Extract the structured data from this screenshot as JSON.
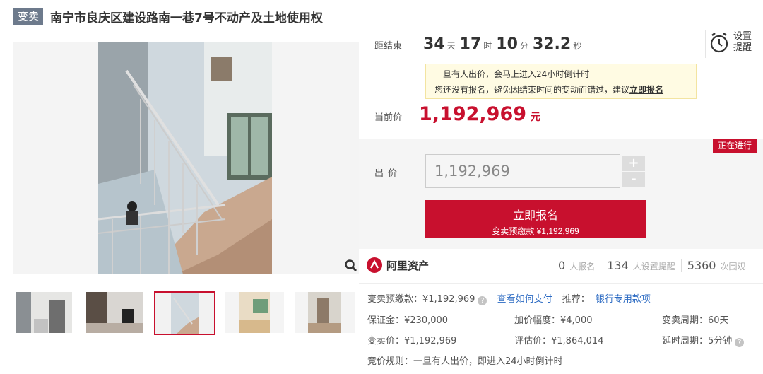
{
  "header": {
    "tag": "变卖",
    "title": "南宁市良庆区建设路南一巷7号不动产及土地使用权"
  },
  "countdown": {
    "label": "距结束",
    "days": "34",
    "days_unit": "天",
    "hours": "17",
    "hours_unit": "时",
    "minutes": "10",
    "minutes_unit": "分",
    "seconds": "32.2",
    "seconds_unit": "秒"
  },
  "reminder": {
    "label": "设置提醒",
    "icon": "alarm-clock-icon"
  },
  "notice": {
    "line1": "一旦有人出价，会马上进入24小时倒计时",
    "line2_prefix": "您还没有报名，避免因结束时间的变动而错过，建议",
    "line2_link": "立即报名"
  },
  "current_price": {
    "label": "当前价",
    "value": "1,192,969",
    "unit": "元"
  },
  "status": "正在进行",
  "bid": {
    "label": "出价",
    "value": "1,192,969",
    "plus": "+",
    "minus": "-",
    "cta_main": "立即报名",
    "cta_sub": "变卖预缴款 ¥1,192,969"
  },
  "brand": {
    "name": "阿里资产",
    "icon": "ali-assets-logo-icon"
  },
  "stats": [
    {
      "num": "0",
      "label": "人报名"
    },
    {
      "num": "134",
      "label": "人设置提醒"
    },
    {
      "num": "5360",
      "label": "次围观"
    }
  ],
  "info": {
    "deposit_label": "变卖预缴款：¥1,192,969",
    "how_to_pay": "查看如何支付",
    "recommend_label": "推荐：",
    "bank_link": "银行专用款项",
    "margin": "保证金：¥230,000",
    "increment": "加价幅度：¥4,000",
    "period": "变卖周期：60天",
    "sale_price": "变卖价：¥1,192,969",
    "appraisal": "评估价：¥1,864,014",
    "delay": "延时周期：5分钟",
    "rule": "竞价规则：一旦有人出价，即进入24小时倒计时"
  },
  "colors": {
    "brand_red": "#c8102e",
    "tag_bg": "#6d7a8c",
    "link_blue": "#2b6ac2"
  }
}
